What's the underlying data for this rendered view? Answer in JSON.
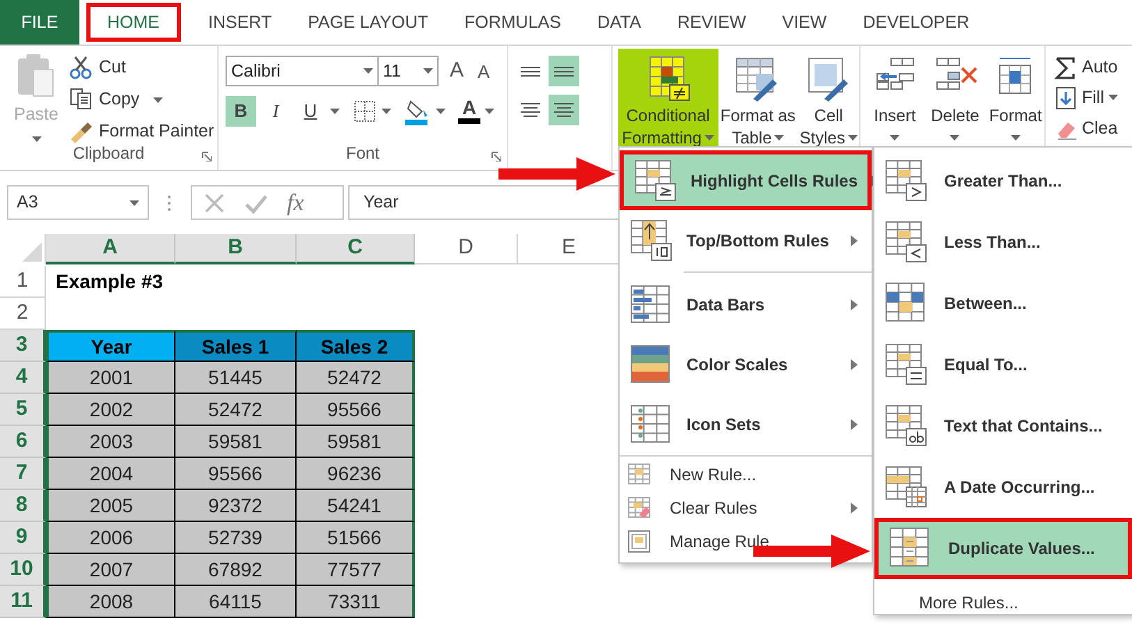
{
  "tabs": [
    {
      "label": "FILE",
      "kind": "file",
      "selected": false,
      "callout": false
    },
    {
      "label": "HOME",
      "kind": "tab",
      "selected": true,
      "callout": true
    },
    {
      "label": "INSERT",
      "kind": "tab",
      "selected": false,
      "callout": false
    },
    {
      "label": "PAGE LAYOUT",
      "kind": "tab",
      "selected": false,
      "callout": false
    },
    {
      "label": "FORMULAS",
      "kind": "tab",
      "selected": false,
      "callout": false
    },
    {
      "label": "DATA",
      "kind": "tab",
      "selected": false,
      "callout": false
    },
    {
      "label": "REVIEW",
      "kind": "tab",
      "selected": false,
      "callout": false
    },
    {
      "label": "VIEW",
      "kind": "tab",
      "selected": false,
      "callout": false
    },
    {
      "label": "DEVELOPER",
      "kind": "tab",
      "selected": false,
      "callout": false
    }
  ],
  "ribbon": {
    "clipboard": {
      "label": "Clipboard",
      "paste": {
        "label": "Paste",
        "disabled": true
      },
      "commands": [
        {
          "label": "Cut",
          "kind": "cut",
          "dropdown": false
        },
        {
          "label": "Copy",
          "kind": "copy",
          "dropdown": true
        },
        {
          "label": "Format Painter",
          "kind": "painter",
          "dropdown": false
        }
      ]
    },
    "font": {
      "label": "Font",
      "font_name": "Calibri",
      "font_size": "11",
      "size_buttons": [
        "A",
        "A"
      ],
      "styles": [
        {
          "label": "B",
          "selected": true
        },
        {
          "label": "I",
          "selected": false
        },
        {
          "label": "U",
          "selected": false
        }
      ],
      "font_color": "A"
    },
    "alignment": {
      "rows": [
        [
          {
            "selected": false
          },
          {
            "selected": true
          }
        ],
        [
          {
            "selected": false
          },
          {
            "selected": true
          }
        ]
      ]
    },
    "styles": [
      {
        "label": [
          "Conditional",
          "Formatting"
        ],
        "kind": "conditional",
        "selected": true
      },
      {
        "label": [
          "Format as",
          "Table"
        ],
        "kind": "table",
        "selected": false
      },
      {
        "label": [
          "Cell",
          "Styles"
        ],
        "kind": "cellstyles",
        "selected": false
      }
    ],
    "cells": [
      {
        "label": "Insert",
        "kind": "insert"
      },
      {
        "label": "Delete",
        "kind": "delete"
      },
      {
        "label": "Format",
        "kind": "format"
      }
    ],
    "editing": [
      {
        "label": "Auto",
        "kind": "sum"
      },
      {
        "label": "Fill",
        "kind": "fill"
      },
      {
        "label": "Clea",
        "kind": "clear"
      }
    ]
  },
  "formula_bar": {
    "name_box": "A3",
    "function_label": "fx",
    "value": "Year"
  },
  "sheet": {
    "columns": [
      {
        "label": "A",
        "selected": true
      },
      {
        "label": "B",
        "selected": true
      },
      {
        "label": "C",
        "selected": true
      },
      {
        "label": "D",
        "selected": false
      },
      {
        "label": "E",
        "selected": false
      }
    ],
    "rows": [
      {
        "number": "1",
        "selected": false,
        "kind": "title",
        "cells": [
          "Example #3"
        ]
      },
      {
        "number": "2",
        "selected": false,
        "kind": "blank"
      },
      {
        "number": "3",
        "selected": true,
        "kind": "header",
        "cells": [
          {
            "text": "Year",
            "active": true
          },
          {
            "text": "Sales 1",
            "active": false
          },
          {
            "text": "Sales 2",
            "active": false
          }
        ]
      },
      {
        "number": "4",
        "selected": true,
        "kind": "data",
        "cells": [
          "2001",
          "51445",
          "52472"
        ]
      },
      {
        "number": "5",
        "selected": true,
        "kind": "data",
        "cells": [
          "2002",
          "52472",
          "95566"
        ]
      },
      {
        "number": "6",
        "selected": true,
        "kind": "data",
        "cells": [
          "2003",
          "59581",
          "59581"
        ]
      },
      {
        "number": "7",
        "selected": true,
        "kind": "data",
        "cells": [
          "2004",
          "95566",
          "96236"
        ]
      },
      {
        "number": "8",
        "selected": true,
        "kind": "data",
        "cells": [
          "2005",
          "92372",
          "54241"
        ]
      },
      {
        "number": "9",
        "selected": true,
        "kind": "data",
        "cells": [
          "2006",
          "52739",
          "51566"
        ]
      },
      {
        "number": "10",
        "selected": true,
        "kind": "data",
        "cells": [
          "2007",
          "67892",
          "77577"
        ]
      },
      {
        "number": "11",
        "selected": true,
        "kind": "data",
        "cells": [
          "2008",
          "64115",
          "73311"
        ]
      }
    ]
  },
  "menu": {
    "items": [
      {
        "label": "Highlight Cells Rules",
        "kind": "highlight",
        "selected": true,
        "callout": true,
        "submenu": true,
        "separator_before": false
      },
      {
        "label": "Top/Bottom Rules",
        "kind": "topbottom",
        "selected": false,
        "callout": false,
        "submenu": true,
        "separator_before": false
      },
      {
        "label": "Data Bars",
        "kind": "databars",
        "selected": false,
        "callout": false,
        "submenu": true,
        "separator_before": true
      },
      {
        "label": "Color Scales",
        "kind": "colorscales",
        "selected": false,
        "callout": false,
        "submenu": true,
        "separator_before": false
      },
      {
        "label": "Icon Sets",
        "kind": "iconsets",
        "selected": false,
        "callout": false,
        "submenu": true,
        "separator_before": false
      },
      {
        "label": "New Rule...",
        "kind": "newrule",
        "selected": false,
        "callout": false,
        "submenu": false,
        "separator_before": true
      },
      {
        "label": "Clear Rules",
        "kind": "clearrules",
        "selected": false,
        "callout": false,
        "submenu": true,
        "separator_before": false
      },
      {
        "label": "Manage Rule",
        "kind": "managerules",
        "selected": false,
        "callout": false,
        "submenu": false,
        "separator_before": false
      }
    ]
  },
  "submenu": {
    "items": [
      {
        "label": "Greater Than...",
        "kind": "greater",
        "selected": false,
        "callout": false
      },
      {
        "label": "Less Than...",
        "kind": "less",
        "selected": false,
        "callout": false
      },
      {
        "label": "Between...",
        "kind": "between",
        "selected": false,
        "callout": false
      },
      {
        "label": "Equal To...",
        "kind": "equal",
        "selected": false,
        "callout": false
      },
      {
        "label": "Text that Contains...",
        "kind": "text",
        "selected": false,
        "callout": false
      },
      {
        "label": "A Date Occurring...",
        "kind": "date",
        "selected": false,
        "callout": false
      },
      {
        "label": "Duplicate Values...",
        "kind": "duplicate",
        "selected": true,
        "callout": true
      },
      {
        "label": "More Rules...",
        "kind": "more",
        "selected": false,
        "callout": false
      }
    ]
  }
}
